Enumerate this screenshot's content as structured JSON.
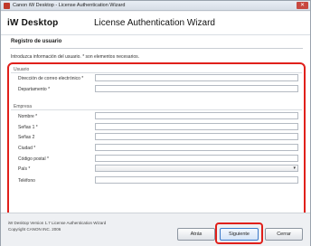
{
  "window": {
    "title": "Canon iW Desktop - License Authentication Wizard",
    "close_glyph": "✕"
  },
  "header": {
    "brand": "iW Desktop",
    "wizard_title": "License Authentication Wizard"
  },
  "page": {
    "section_title": "Registro de usuario",
    "instructions": "Introduzca información del usuario. * son elementos necesarios."
  },
  "user_group": {
    "label": "Usuario",
    "fields": [
      {
        "label": "Dirección de correo electrónico *",
        "value": ""
      },
      {
        "label": "Departamento *",
        "value": ""
      }
    ]
  },
  "company_group": {
    "label": "Empresa",
    "fields": [
      {
        "label": "Nombre *",
        "value": ""
      },
      {
        "label": "Señas 1 *",
        "value": ""
      },
      {
        "label": "Señas 2",
        "value": ""
      },
      {
        "label": "Ciudad *",
        "value": ""
      },
      {
        "label": "Código postal *",
        "value": ""
      },
      {
        "label": "País *",
        "value": "",
        "type": "select"
      },
      {
        "label": "Teléfono",
        "value": ""
      }
    ]
  },
  "footer": {
    "product_line": "iW Desktop Version 1.7  License Authentication Wizard",
    "copyright": "Copyright CANON INC. 2006",
    "back_label": "Atrás",
    "next_label": "Siguiente",
    "cancel_label": "Cerrar"
  },
  "colors": {
    "highlight": "#e0201b",
    "accent": "#3b79c9"
  }
}
